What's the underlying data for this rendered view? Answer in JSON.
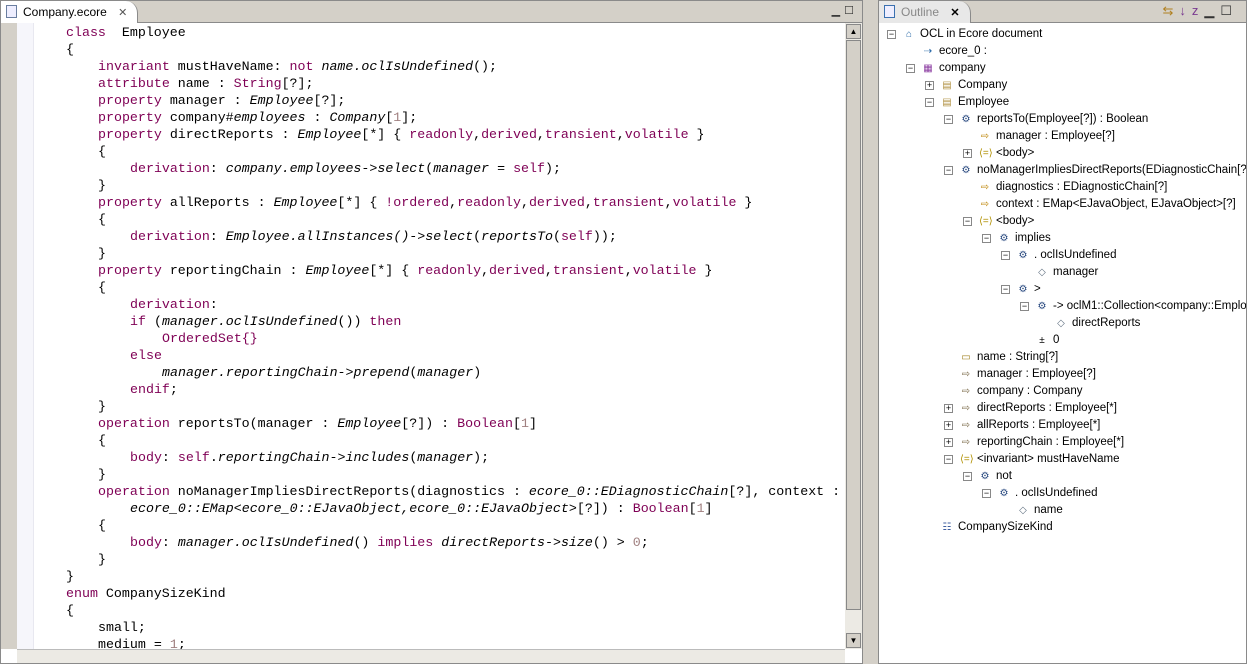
{
  "editor": {
    "tab_label": "Company.ecore",
    "tab_icon": "ecore-file-icon",
    "lines": [
      {
        "ind": 1,
        "fold": true,
        "t": [
          [
            "k",
            "class"
          ],
          [
            "",
            "  Employee"
          ]
        ]
      },
      {
        "ind": 1,
        "t": [
          [
            "",
            "{"
          ]
        ]
      },
      {
        "ind": 2,
        "t": [
          [
            "k",
            "invariant"
          ],
          [
            "",
            " mustHaveName: "
          ],
          [
            "k",
            "not"
          ],
          [
            "",
            " "
          ],
          [
            "i",
            "name.oclIsUndefined"
          ],
          [
            "",
            "();"
          ]
        ]
      },
      {
        "ind": 2,
        "t": [
          [
            "k",
            "attribute"
          ],
          [
            "",
            " name : "
          ],
          [
            "k",
            "String"
          ],
          [
            "",
            "[?];"
          ]
        ]
      },
      {
        "ind": 2,
        "t": [
          [
            "k",
            "property"
          ],
          [
            "",
            " manager : "
          ],
          [
            "i",
            "Employee"
          ],
          [
            "",
            "[?];"
          ]
        ]
      },
      {
        "ind": 2,
        "t": [
          [
            "k",
            "property"
          ],
          [
            "",
            " company#"
          ],
          [
            "i",
            "employees"
          ],
          [
            "",
            " : "
          ],
          [
            "i",
            "Company"
          ],
          [
            "",
            "["
          ],
          [
            "n",
            "1"
          ],
          [
            "",
            "];"
          ]
        ]
      },
      {
        "ind": 2,
        "fold": true,
        "t": [
          [
            "k",
            "property"
          ],
          [
            "",
            " directReports : "
          ],
          [
            "i",
            "Employee"
          ],
          [
            "",
            "[*] { "
          ],
          [
            "k",
            "readonly"
          ],
          [
            "",
            ","
          ],
          [
            "k",
            "derived"
          ],
          [
            "",
            ","
          ],
          [
            "k",
            "transient"
          ],
          [
            "",
            ","
          ],
          [
            "k",
            "volatile"
          ],
          [
            "",
            " }"
          ]
        ]
      },
      {
        "ind": 2,
        "t": [
          [
            "",
            "{"
          ]
        ]
      },
      {
        "ind": 3,
        "t": [
          [
            "k",
            "derivation"
          ],
          [
            "",
            ": "
          ],
          [
            "i",
            "company.employees->select"
          ],
          [
            "",
            "("
          ],
          [
            "i",
            "manager"
          ],
          [
            "",
            " = "
          ],
          [
            "k",
            "self"
          ],
          [
            "",
            ");"
          ]
        ]
      },
      {
        "ind": 2,
        "t": [
          [
            "",
            "}"
          ]
        ]
      },
      {
        "ind": 2,
        "fold": true,
        "t": [
          [
            "k",
            "property"
          ],
          [
            "",
            " allReports : "
          ],
          [
            "i",
            "Employee"
          ],
          [
            "",
            "[*] { "
          ],
          [
            "k",
            "!ordered"
          ],
          [
            "",
            ","
          ],
          [
            "k",
            "readonly"
          ],
          [
            "",
            ","
          ],
          [
            "k",
            "derived"
          ],
          [
            "",
            ","
          ],
          [
            "k",
            "transient"
          ],
          [
            "",
            ","
          ],
          [
            "k",
            "volatile"
          ],
          [
            "",
            " }"
          ]
        ]
      },
      {
        "ind": 2,
        "t": [
          [
            "",
            "{"
          ]
        ]
      },
      {
        "ind": 3,
        "t": [
          [
            "k",
            "derivation"
          ],
          [
            "",
            ": "
          ],
          [
            "i",
            "Employee.allInstances()->select"
          ],
          [
            "",
            "("
          ],
          [
            "i",
            "reportsTo"
          ],
          [
            "",
            "("
          ],
          [
            "k",
            "self"
          ],
          [
            "",
            "));"
          ]
        ]
      },
      {
        "ind": 2,
        "t": [
          [
            "",
            "}"
          ]
        ]
      },
      {
        "ind": 2,
        "fold": true,
        "t": [
          [
            "k",
            "property"
          ],
          [
            "",
            " reportingChain : "
          ],
          [
            "i",
            "Employee"
          ],
          [
            "",
            "[*] { "
          ],
          [
            "k",
            "readonly"
          ],
          [
            "",
            ","
          ],
          [
            "k",
            "derived"
          ],
          [
            "",
            ","
          ],
          [
            "k",
            "transient"
          ],
          [
            "",
            ","
          ],
          [
            "k",
            "volatile"
          ],
          [
            "",
            " }"
          ]
        ]
      },
      {
        "ind": 2,
        "t": [
          [
            "",
            "{"
          ]
        ]
      },
      {
        "ind": 3,
        "fold": true,
        "t": [
          [
            "k",
            "derivation"
          ],
          [
            "",
            ":"
          ]
        ]
      },
      {
        "ind": 3,
        "fold": true,
        "t": [
          [
            "k",
            "if"
          ],
          [
            "",
            " ("
          ],
          [
            "i",
            "manager.oclIsUndefined"
          ],
          [
            "",
            "()) "
          ],
          [
            "k",
            "then"
          ]
        ]
      },
      {
        "ind": 4,
        "t": [
          [
            "k",
            "OrderedSet"
          ],
          [
            "k",
            "{}"
          ]
        ]
      },
      {
        "ind": 3,
        "t": [
          [
            "k",
            "else"
          ]
        ]
      },
      {
        "ind": 4,
        "t": [
          [
            "i",
            "manager.reportingChain->prepend"
          ],
          [
            "",
            "("
          ],
          [
            "i",
            "manager"
          ],
          [
            "",
            ")"
          ]
        ]
      },
      {
        "ind": 3,
        "t": [
          [
            "k",
            "endif"
          ],
          [
            "",
            ";"
          ]
        ]
      },
      {
        "ind": 2,
        "t": [
          [
            "",
            "}"
          ]
        ]
      },
      {
        "ind": 2,
        "fold": true,
        "t": [
          [
            "k",
            "operation"
          ],
          [
            "",
            " reportsTo(manager : "
          ],
          [
            "i",
            "Employee"
          ],
          [
            "",
            "[?]) : "
          ],
          [
            "k",
            "Boolean"
          ],
          [
            "",
            "["
          ],
          [
            "n",
            "1"
          ],
          [
            "",
            "]"
          ]
        ]
      },
      {
        "ind": 2,
        "t": [
          [
            "",
            "{"
          ]
        ]
      },
      {
        "ind": 3,
        "t": [
          [
            "k",
            "body"
          ],
          [
            "",
            ": "
          ],
          [
            "k",
            "self"
          ],
          [
            "",
            "."
          ],
          [
            "i",
            "reportingChain->includes"
          ],
          [
            "",
            "("
          ],
          [
            "i",
            "manager"
          ],
          [
            "",
            ");"
          ]
        ]
      },
      {
        "ind": 2,
        "t": [
          [
            "",
            "}"
          ]
        ]
      },
      {
        "ind": 2,
        "fold": true,
        "t": [
          [
            "k",
            "operation"
          ],
          [
            "",
            " noManagerImpliesDirectReports(diagnostics : "
          ],
          [
            "i",
            "ecore_0::EDiagnosticChain"
          ],
          [
            "",
            "[?], context :"
          ]
        ]
      },
      {
        "ind": 3,
        "t": [
          [
            "i",
            "ecore_0::EMap<ecore_0::EJavaObject,ecore_0::EJavaObject>"
          ],
          [
            "",
            "[?]) : "
          ],
          [
            "k",
            "Boolean"
          ],
          [
            "",
            "["
          ],
          [
            "n",
            "1"
          ],
          [
            "",
            "]"
          ]
        ]
      },
      {
        "ind": 2,
        "t": [
          [
            "",
            "{"
          ]
        ]
      },
      {
        "ind": 3,
        "t": [
          [
            "k",
            "body"
          ],
          [
            "",
            ": "
          ],
          [
            "i",
            "manager.oclIsUndefined"
          ],
          [
            "",
            "() "
          ],
          [
            "k",
            "implies"
          ],
          [
            "",
            " "
          ],
          [
            "i",
            "directReports->size"
          ],
          [
            "",
            "() > "
          ],
          [
            "n",
            "0"
          ],
          [
            "",
            ";"
          ]
        ]
      },
      {
        "ind": 2,
        "t": [
          [
            "",
            "}"
          ]
        ]
      },
      {
        "ind": 1,
        "t": [
          [
            "",
            "}"
          ]
        ]
      },
      {
        "ind": 1,
        "fold": true,
        "t": [
          [
            "k",
            "enum"
          ],
          [
            "",
            " CompanySizeKind"
          ]
        ]
      },
      {
        "ind": 1,
        "t": [
          [
            "",
            "{"
          ]
        ]
      },
      {
        "ind": 2,
        "t": [
          [
            "",
            "small;"
          ]
        ]
      },
      {
        "ind": 2,
        "t": [
          [
            "",
            "medium = "
          ],
          [
            "n",
            "1"
          ],
          [
            "",
            ";"
          ]
        ]
      }
    ]
  },
  "outline": {
    "tab_label": "Outline",
    "rows": [
      {
        "lvl": 0,
        "exp": "-",
        "icon": "document-icon",
        "label": "OCL in Ecore document"
      },
      {
        "lvl": 1,
        "exp": "",
        "icon": "import-icon",
        "label": "ecore_0 :"
      },
      {
        "lvl": 1,
        "exp": "-",
        "icon": "package-icon",
        "label": "company"
      },
      {
        "lvl": 2,
        "exp": "+",
        "icon": "class-icon",
        "label": "Company"
      },
      {
        "lvl": 2,
        "exp": "-",
        "icon": "class-icon",
        "label": "Employee"
      },
      {
        "lvl": 3,
        "exp": "-",
        "icon": "operation-icon",
        "label": "reportsTo(Employee[?]) : Boolean"
      },
      {
        "lvl": 4,
        "exp": "",
        "icon": "parameter-icon",
        "label": "manager : Employee[?]"
      },
      {
        "lvl": 4,
        "exp": "+",
        "icon": "body-icon",
        "label": "<body>"
      },
      {
        "lvl": 3,
        "exp": "-",
        "icon": "operation-icon",
        "label": "noManagerImpliesDirectReports(EDiagnosticChain[?],"
      },
      {
        "lvl": 4,
        "exp": "",
        "icon": "parameter-icon",
        "label": "diagnostics : EDiagnosticChain[?]"
      },
      {
        "lvl": 4,
        "exp": "",
        "icon": "parameter-icon",
        "label": "context : EMap<EJavaObject, EJavaObject>[?]"
      },
      {
        "lvl": 4,
        "exp": "-",
        "icon": "body-icon",
        "label": "<body>"
      },
      {
        "lvl": 5,
        "exp": "-",
        "icon": "call-icon",
        "label": "implies"
      },
      {
        "lvl": 6,
        "exp": "-",
        "icon": "call-icon",
        "label": ". oclIsUndefined"
      },
      {
        "lvl": 7,
        "exp": "",
        "icon": "variable-icon",
        "label": "manager"
      },
      {
        "lvl": 6,
        "exp": "-",
        "icon": "call-icon",
        "label": ">"
      },
      {
        "lvl": 7,
        "exp": "-",
        "icon": "call-icon",
        "label": "-> oclM1::Collection<company::Emplo"
      },
      {
        "lvl": 8,
        "exp": "",
        "icon": "variable-icon",
        "label": "directReports"
      },
      {
        "lvl": 7,
        "exp": "",
        "icon": "integer-literal-icon",
        "label": "0"
      },
      {
        "lvl": 3,
        "exp": "",
        "icon": "attribute-icon",
        "label": "name : String[?]"
      },
      {
        "lvl": 3,
        "exp": "",
        "icon": "reference-icon",
        "label": "manager : Employee[?]"
      },
      {
        "lvl": 3,
        "exp": "",
        "icon": "reference-icon",
        "label": "company : Company"
      },
      {
        "lvl": 3,
        "exp": "+",
        "icon": "reference-icon",
        "label": "directReports : Employee[*]"
      },
      {
        "lvl": 3,
        "exp": "+",
        "icon": "reference-icon",
        "label": "allReports : Employee[*]"
      },
      {
        "lvl": 3,
        "exp": "+",
        "icon": "reference-icon",
        "label": "reportingChain : Employee[*]"
      },
      {
        "lvl": 3,
        "exp": "-",
        "icon": "body-icon",
        "label": "<invariant> mustHaveName"
      },
      {
        "lvl": 4,
        "exp": "-",
        "icon": "call-icon",
        "label": "not"
      },
      {
        "lvl": 5,
        "exp": "-",
        "icon": "call-icon",
        "label": ". oclIsUndefined"
      },
      {
        "lvl": 6,
        "exp": "",
        "icon": "variable-icon",
        "label": "name"
      },
      {
        "lvl": 2,
        "exp": "",
        "icon": "enum-icon",
        "label": "CompanySizeKind"
      }
    ]
  }
}
